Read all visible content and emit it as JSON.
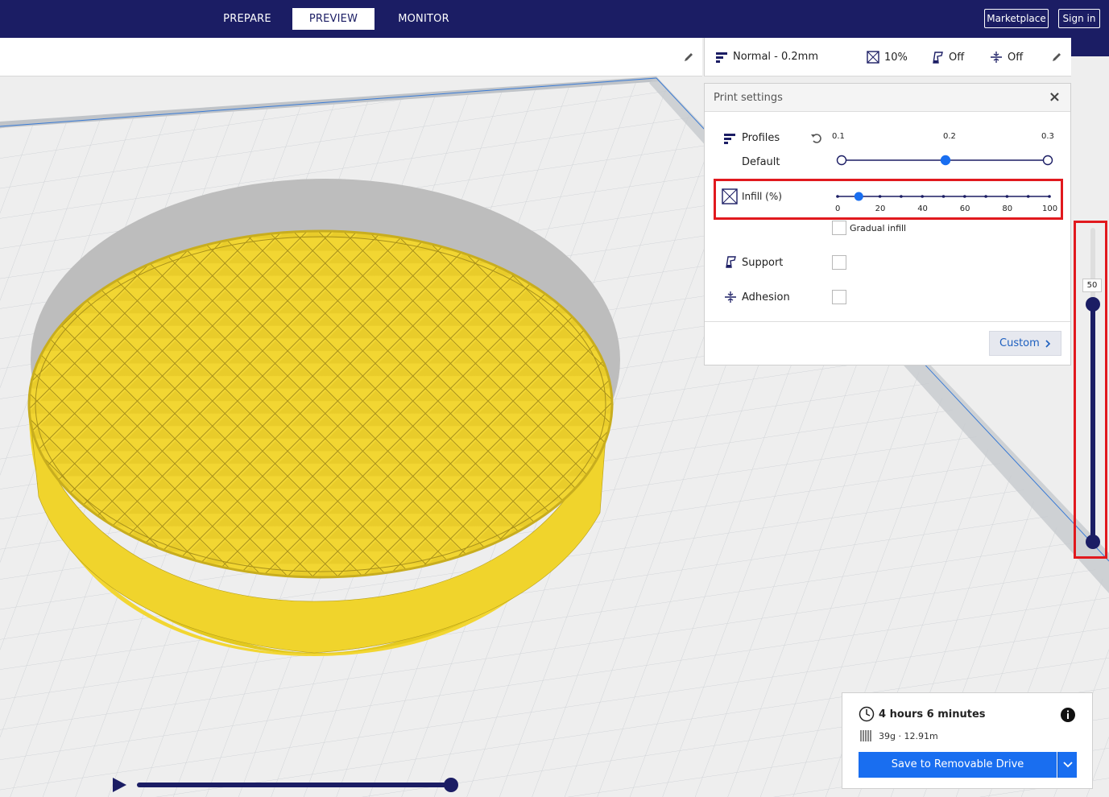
{
  "stages": [
    {
      "label": "PREPARE",
      "active": false
    },
    {
      "label": "PREVIEW",
      "active": true
    },
    {
      "label": "MONITOR",
      "active": false
    }
  ],
  "top_buttons": {
    "marketplace": "Marketplace",
    "sign_in": "Sign in"
  },
  "print_setup": {
    "profile": "Normal - 0.2mm",
    "infill": "10%",
    "support": "Off",
    "adhesion": "Off"
  },
  "print_settings": {
    "title": "Print settings",
    "profiles_label": "Profiles",
    "profile_name": "Default",
    "layer_heights": [
      "0.1",
      "0.2",
      "0.3"
    ],
    "layer_height_selected": "0.2",
    "infill_label": "Infill (%)",
    "infill_ticks": [
      "0",
      "20",
      "40",
      "60",
      "80",
      "100"
    ],
    "infill_value": 10,
    "gradual_infill_label": "Gradual infill",
    "gradual_infill_checked": false,
    "support_label": "Support",
    "support_checked": false,
    "adhesion_label": "Adhesion",
    "adhesion_checked": false,
    "custom_label": "Custom"
  },
  "layer_view": {
    "current_layer": "50"
  },
  "job": {
    "print_time": "4 hours 6 minutes",
    "material": "39g · 12.91m",
    "save_label": "Save to Removable Drive"
  },
  "colors": {
    "nav": "#1b1d64",
    "accent": "#196ef0",
    "model": "#f2d632",
    "highlight": "#e1191e"
  },
  "icons": [
    "profile-icon",
    "infill-icon",
    "support-icon",
    "adhesion-icon",
    "edit-icon",
    "reset-icon",
    "close-icon",
    "clock-icon",
    "info-icon",
    "spool-icon",
    "chevron-right-icon",
    "chevron-down-icon",
    "play-icon"
  ]
}
